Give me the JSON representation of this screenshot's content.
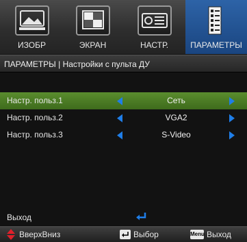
{
  "tabs": [
    {
      "label": "ИЗОБР",
      "icon": "picture-icon"
    },
    {
      "label": "ЭКРАН",
      "icon": "screen-icon"
    },
    {
      "label": "НАСТР.",
      "icon": "projector-icon"
    },
    {
      "label": "ПАРАМЕТРЫ",
      "icon": "options-icon"
    }
  ],
  "active_tab": "ПАРАМЕТРЫ",
  "breadcrumb": "ПАРАМЕТРЫ | Настройки с пульта ДУ",
  "rows": [
    {
      "label": "Настр. польз.1",
      "value": "Сеть",
      "selected": true
    },
    {
      "label": "Настр. польз.2",
      "value": "VGA2",
      "selected": false
    },
    {
      "label": "Настр. польз.3",
      "value": "S-Video",
      "selected": false
    }
  ],
  "exit_label": "Выход",
  "help": {
    "updown": "ВверхВниз",
    "enter_key": "",
    "select": "Выбор",
    "menu_key": "Menu",
    "exit": "Выход"
  },
  "colors": {
    "active_tab": "#2d63a7",
    "selected_row": "#4f7f27",
    "arrow": "#1f7ee8",
    "updown_icon": "#e0202a"
  }
}
